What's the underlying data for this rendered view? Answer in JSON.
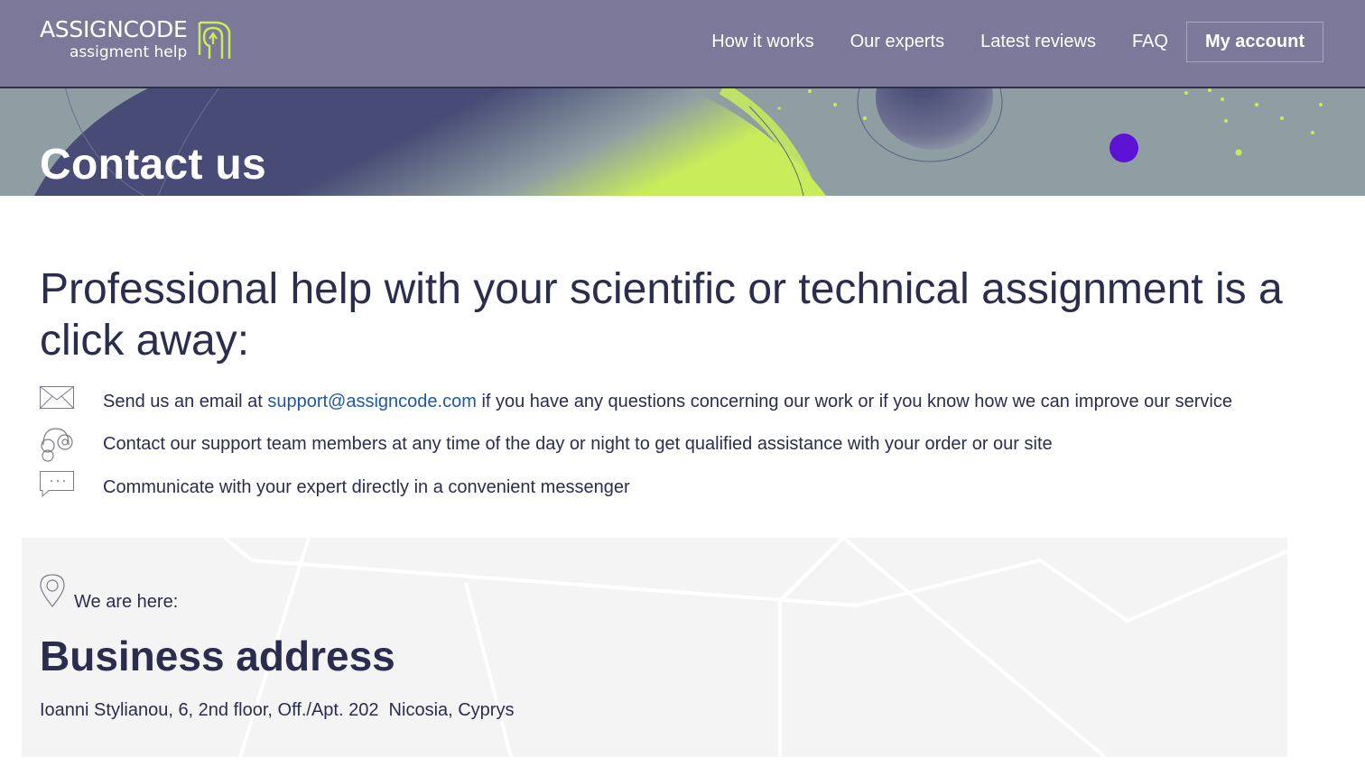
{
  "brand": {
    "name": "ASSIGNCODE",
    "tagline": "assigment help",
    "accent": "#c8ec5a",
    "header_bg": "#7c7899"
  },
  "nav": {
    "items": [
      "How it works",
      "Our experts",
      "Latest reviews",
      "FAQ"
    ],
    "account": "My account"
  },
  "hero": {
    "title": "Contact us"
  },
  "main": {
    "headline": "Professional help with your scientific or technical assignment is a click away:",
    "features": [
      {
        "icon": "envelope-icon",
        "prefix": "Send us an email at ",
        "link": "support@assigncode.com",
        "suffix": " if you have any questions concerning our work or if you know how we can improve our service"
      },
      {
        "icon": "headset-icon",
        "text": "Contact our support team members at any time of the day or night to get qualified assistance with your order or our site"
      },
      {
        "icon": "chat-bubble-icon",
        "text": "Communicate with your expert directly in a convenient messenger"
      }
    ]
  },
  "address": {
    "label": "We are here:",
    "title": "Business address",
    "line": "Ioanni Stylianou, 6, 2nd floor, Off./Apt. 202  Nicosia, Cyprys"
  }
}
